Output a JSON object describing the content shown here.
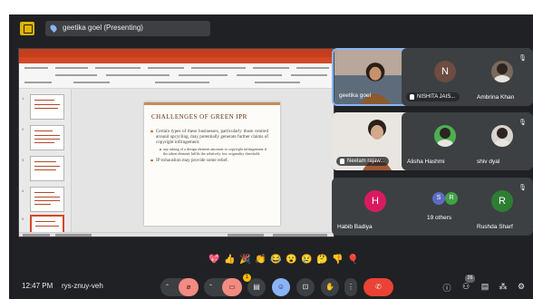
{
  "presenting": {
    "label": "geetika goel (Presenting)",
    "badge_icon": "present-screen-icon",
    "pin_icon": "pin-icon"
  },
  "slide": {
    "title": "CHALLENGES OF GREEN IPR",
    "bullets": [
      "Certain types of these businesses, particularly those centred around upcycling, may potentially generate further claims of copyright infringement.",
      "any taking of a design element amounts to copyright infringement if the taken element fulfils the relatively low originality threshold.",
      "IP exhaustion may provide some relief."
    ]
  },
  "participants": [
    {
      "name": "geetika goel",
      "type": "camera",
      "more_icon": "more-options-icon"
    },
    {
      "name": "NISHITA JAIS...",
      "initial": "N",
      "avatar_color": "#6d4c41",
      "type": "avatar",
      "hand_raised": true,
      "muted": true
    },
    {
      "name": "Ambrina Khan",
      "type": "photo",
      "muted": true
    },
    {
      "name": "Neelam rajaw...",
      "type": "camera",
      "hand_raised": true,
      "muted": true
    },
    {
      "name": "Alisha Hashmi",
      "type": "photo",
      "muted": true
    },
    {
      "name": "shiv dyal",
      "type": "photo",
      "muted": true
    },
    {
      "name": "Habib Badiya",
      "initial": "H",
      "avatar_color": "#d81b60",
      "type": "avatar",
      "muted": true
    },
    {
      "name": "19 others",
      "initials": [
        "S",
        "R"
      ],
      "avatar_colors": [
        "#5c6bc0",
        "#43a047"
      ],
      "type": "group"
    },
    {
      "name": "Rushda Sharf",
      "initial": "R",
      "avatar_color": "#2e7d32",
      "type": "avatar",
      "muted": true
    }
  ],
  "reactions": [
    "💖",
    "👍",
    "🎉",
    "👏",
    "😂",
    "😮",
    "😢",
    "🤔",
    "👎",
    "🎈"
  ],
  "bottom_bar": {
    "time": "12:47 PM",
    "meeting_code": "rys-znuy-veh",
    "people_count": "26",
    "reaction_badge": "1"
  },
  "colors": {
    "background": "#202124",
    "tile": "#3c4043",
    "end_call": "#ea4335",
    "muted": "#f28b82",
    "accent": "#8ab4f8"
  }
}
